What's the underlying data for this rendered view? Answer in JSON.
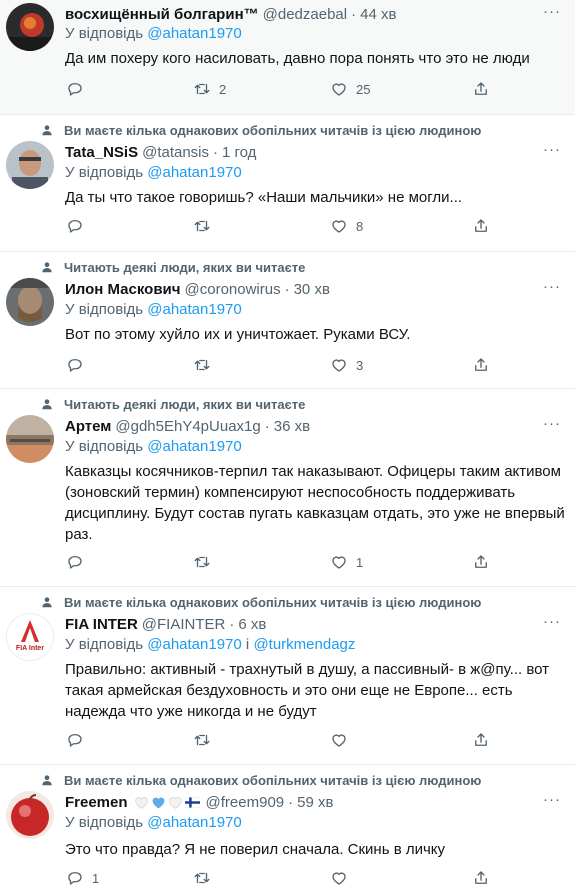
{
  "reply_prefix": "У відповідь",
  "tweets": [
    {
      "social": "",
      "name": "восхищённый болгарин™",
      "handle": "@dedzaebal",
      "dot": "·",
      "time": "44 хв",
      "reply_to": "@ahatan1970",
      "text": "Да им похеру кого насиловать, давно пора понять что это не люди",
      "replies": "",
      "retweets": "2",
      "likes": "25"
    },
    {
      "social": "Ви маєте кілька однакових обопільних читачів із цією людиною",
      "name": "Tata_NSiS",
      "handle": "@tatansis",
      "dot": "·",
      "time": "1 год",
      "reply_to": "@ahatan1970",
      "text": "Да ты что такое говоришь? «Наши мальчики» не могли...",
      "replies": "",
      "retweets": "",
      "likes": "8"
    },
    {
      "social": "Читають деякі люди, яких ви читаєте",
      "name": "Илон Маскович",
      "handle": "@coronowirus",
      "dot": "·",
      "time": "30 хв",
      "reply_to": "@ahatan1970",
      "text": "Вот по этому хуйло их и уничтожает. Руками ВСУ.",
      "replies": "",
      "retweets": "",
      "likes": "3"
    },
    {
      "social": "Читають деякі люди, яких ви читаєте",
      "name": "Артем",
      "handle": "@gdh5EhY4pUuax1g",
      "dot": "·",
      "time": "36 хв",
      "reply_to": "@ahatan1970",
      "text": "Кавказцы косячников-терпил так наказывают. Офицеры таким активом (зоновский термин) компенсируют неспособность поддерживать дисциплину. Будут состав пугать кавказцам отдать, это уже не впервый раз.",
      "replies": "",
      "retweets": "",
      "likes": "1"
    },
    {
      "social": "Ви маєте кілька однакових обопільних читачів із цією людиною",
      "name": "FIA INTER",
      "handle": "@FIAINTER",
      "dot": "·",
      "time": "6 хв",
      "reply_to": "@ahatan1970",
      "reply_and": "і",
      "reply_to2": "@turkmendagz",
      "text": "Правильно: активный - трахнутый в душу, а пассивный- в ж@пу... вот такая армейская бездуховность и это они еще не Европе... есть надежда что уже никогда и не будут",
      "avatar_text": "FIA Inter",
      "replies": "",
      "retweets": "",
      "likes": ""
    },
    {
      "social": "Ви маєте кілька однакових обопільних читачів із цією людиною",
      "name": "Freemen",
      "handle": "@freem909",
      "dot": "·",
      "time": "59 хв",
      "reply_to": "@ahatan1970",
      "text": "Это что правда? Я не поверил сначала. Скинь в личку",
      "replies": "1",
      "retweets": "",
      "likes": ""
    }
  ],
  "more_label": "···",
  "icons": {
    "reply": "reply-icon",
    "retweet": "retweet-icon",
    "like": "heart-icon",
    "share": "share-icon",
    "social": "person-icon"
  },
  "colors": {
    "link": "#1d9bf0",
    "muted": "#536471",
    "text": "#0f1419"
  }
}
